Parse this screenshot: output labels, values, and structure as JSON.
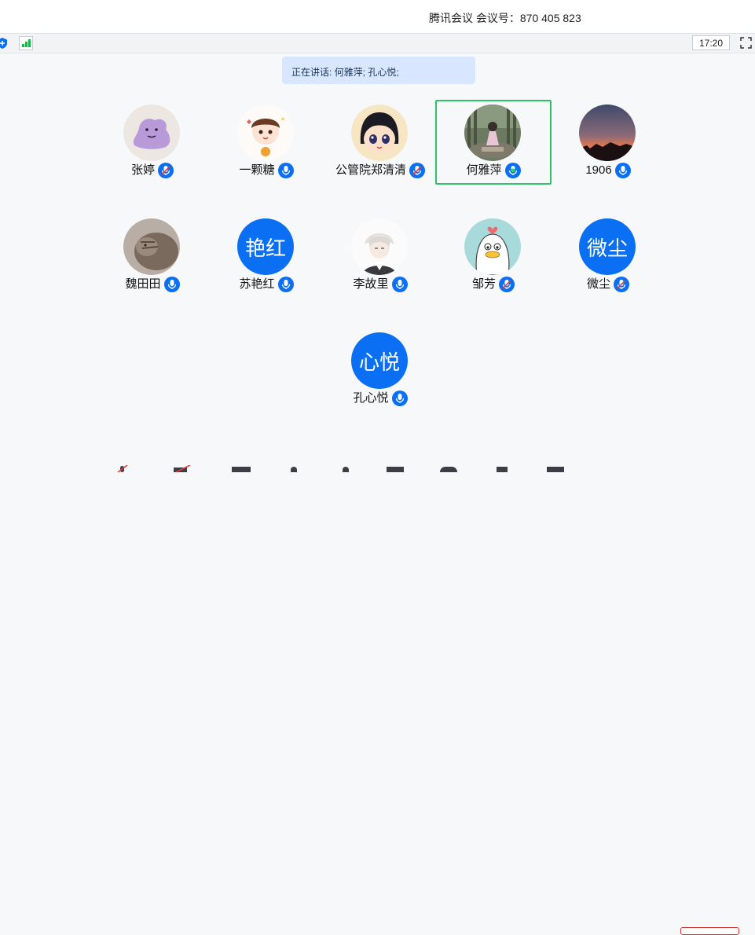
{
  "window": {
    "title": "腾讯会议  会议号：870 405 823"
  },
  "status": {
    "time": "17:20"
  },
  "speaking": {
    "text": "正在讲话: 何雅萍; 孔心悦;"
  },
  "colors": {
    "accent": "#0a6ff2",
    "active_border": "#2bc46b",
    "signal": "#1fb34e"
  },
  "participants": [
    {
      "name": "张婷",
      "avatar": "ditto-avatar-image",
      "mic": "muted"
    },
    {
      "name": "一颗糖",
      "avatar": "cartoon-girl-avatar-image",
      "mic": "on"
    },
    {
      "name": "公管院郑清清",
      "avatar": "anime-girl-avatar-image",
      "mic": "muted"
    },
    {
      "name": "何雅萍",
      "avatar": "photo-avatar-image",
      "mic": "speaking",
      "active": true
    },
    {
      "name": "1906",
      "avatar": "sunset-avatar-image",
      "mic": "on"
    },
    {
      "name": "魏田田",
      "avatar": "cat-avatar-image",
      "mic": "on"
    },
    {
      "name": "苏艳红",
      "avatar_text": "艳红",
      "mic": "on"
    },
    {
      "name": "李故里",
      "avatar": "anime-boy-avatar-image",
      "mic": "on"
    },
    {
      "name": "邹芳",
      "avatar": "duck-avatar-image",
      "mic": "muted"
    },
    {
      "name": "微尘",
      "avatar_text": "微尘",
      "mic": "muted"
    },
    {
      "name": "孔心悦",
      "avatar_text": "心悦",
      "mic": "on"
    }
  ]
}
